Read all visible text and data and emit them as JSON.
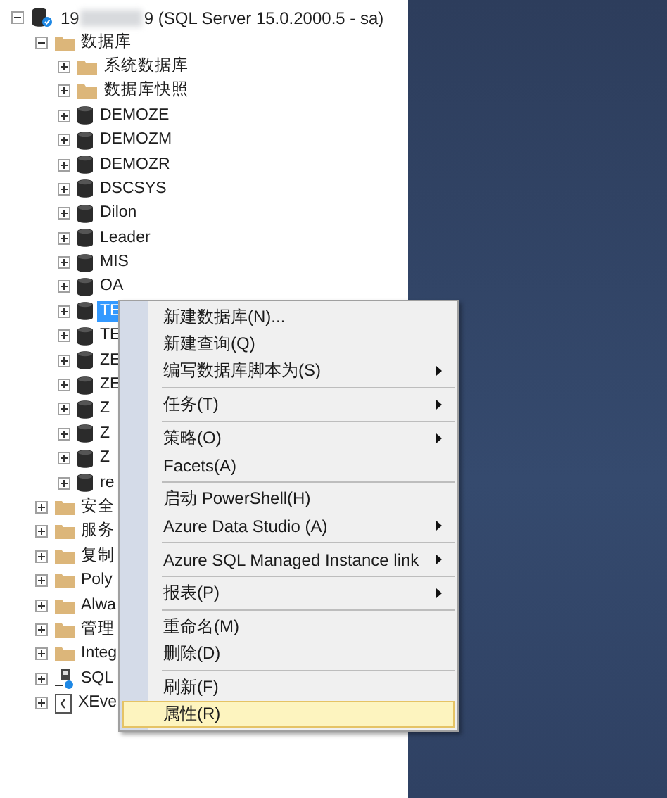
{
  "object_explorer": {
    "server": {
      "label_start": "19",
      "label_end": "9 (SQL Server 15.0.2000.5 - sa)",
      "expanded": true,
      "children": [
        {
          "label": "数据库",
          "kind": "folder",
          "expanded": true,
          "children": [
            {
              "label": "系统数据库",
              "kind": "folder",
              "expanded": false,
              "selected": false
            },
            {
              "label": "数据库快照",
              "kind": "folder",
              "expanded": false,
              "selected": false
            },
            {
              "label": "DEMOZE",
              "kind": "database",
              "expanded": false,
              "selected": false
            },
            {
              "label": "DEMOZM",
              "kind": "database",
              "expanded": false,
              "selected": false
            },
            {
              "label": "DEMOZR",
              "kind": "database",
              "expanded": false,
              "selected": false
            },
            {
              "label": "DSCSYS",
              "kind": "database",
              "expanded": false,
              "selected": false
            },
            {
              "label": "Dilon",
              "kind": "database",
              "expanded": false,
              "selected": false
            },
            {
              "label": "Leader",
              "kind": "database",
              "expanded": false,
              "selected": false
            },
            {
              "label": "MIS",
              "kind": "database",
              "expanded": false,
              "selected": false
            },
            {
              "label": "OA",
              "kind": "database",
              "expanded": false,
              "selected": false
            },
            {
              "label": "TE",
              "kind": "database",
              "expanded": false,
              "selected": true
            },
            {
              "label": "TE",
              "kind": "database",
              "expanded": false,
              "selected": false
            },
            {
              "label": "ZE",
              "kind": "database",
              "expanded": false,
              "selected": false
            },
            {
              "label": "ZE",
              "kind": "database",
              "expanded": false,
              "selected": false
            },
            {
              "label": "Z",
              "kind": "database",
              "expanded": false,
              "selected": false
            },
            {
              "label": "Z",
              "kind": "database",
              "expanded": false,
              "selected": false
            },
            {
              "label": "Z",
              "kind": "database",
              "expanded": false,
              "selected": false
            },
            {
              "label": "re",
              "kind": "database",
              "expanded": false,
              "selected": false
            }
          ],
          "selected": false
        },
        {
          "label": "安全",
          "kind": "folder",
          "expanded": false,
          "selected": false
        },
        {
          "label": "服务",
          "kind": "folder",
          "expanded": false,
          "selected": false
        },
        {
          "label": "复制",
          "kind": "folder",
          "expanded": false,
          "selected": false
        },
        {
          "label": "Poly",
          "kind": "folder",
          "expanded": false,
          "selected": false
        },
        {
          "label": "Alwa",
          "kind": "folder",
          "expanded": false,
          "selected": false
        },
        {
          "label": "管理",
          "kind": "folder",
          "expanded": false,
          "selected": false
        },
        {
          "label": "Integ",
          "kind": "folder",
          "expanded": false,
          "selected": false
        },
        {
          "label": "SQL",
          "kind": "agent",
          "expanded": false,
          "selected": false
        },
        {
          "label": "XEve",
          "kind": "xevent",
          "expanded": false,
          "selected": false
        }
      ]
    }
  },
  "context_menu": {
    "items": [
      {
        "kind": "item",
        "label": "新建数据库(N)...",
        "submenu": false,
        "selected": false
      },
      {
        "kind": "item",
        "label": "新建查询(Q)",
        "submenu": false,
        "selected": false
      },
      {
        "kind": "item",
        "label": "编写数据库脚本为(S)",
        "submenu": true,
        "selected": false
      },
      {
        "kind": "separator"
      },
      {
        "kind": "item",
        "label": "任务(T)",
        "submenu": true,
        "selected": false
      },
      {
        "kind": "separator"
      },
      {
        "kind": "item",
        "label": "策略(O)",
        "submenu": true,
        "selected": false
      },
      {
        "kind": "item",
        "label": "Facets(A)",
        "submenu": false,
        "selected": false
      },
      {
        "kind": "separator"
      },
      {
        "kind": "item",
        "label": "启动 PowerShell(H)",
        "submenu": false,
        "selected": false
      },
      {
        "kind": "item",
        "label": "Azure Data Studio (A)",
        "submenu": true,
        "selected": false
      },
      {
        "kind": "separator"
      },
      {
        "kind": "item",
        "label": "Azure SQL Managed Instance link",
        "submenu": true,
        "selected": false
      },
      {
        "kind": "separator"
      },
      {
        "kind": "item",
        "label": "报表(P)",
        "submenu": true,
        "selected": false
      },
      {
        "kind": "separator"
      },
      {
        "kind": "item",
        "label": "重命名(M)",
        "submenu": false,
        "selected": false
      },
      {
        "kind": "item",
        "label": "删除(D)",
        "submenu": false,
        "selected": false
      },
      {
        "kind": "separator"
      },
      {
        "kind": "item",
        "label": "刷新(F)",
        "submenu": false,
        "selected": false
      },
      {
        "kind": "item",
        "label": "属性(R)",
        "submenu": false,
        "selected": true
      }
    ]
  }
}
